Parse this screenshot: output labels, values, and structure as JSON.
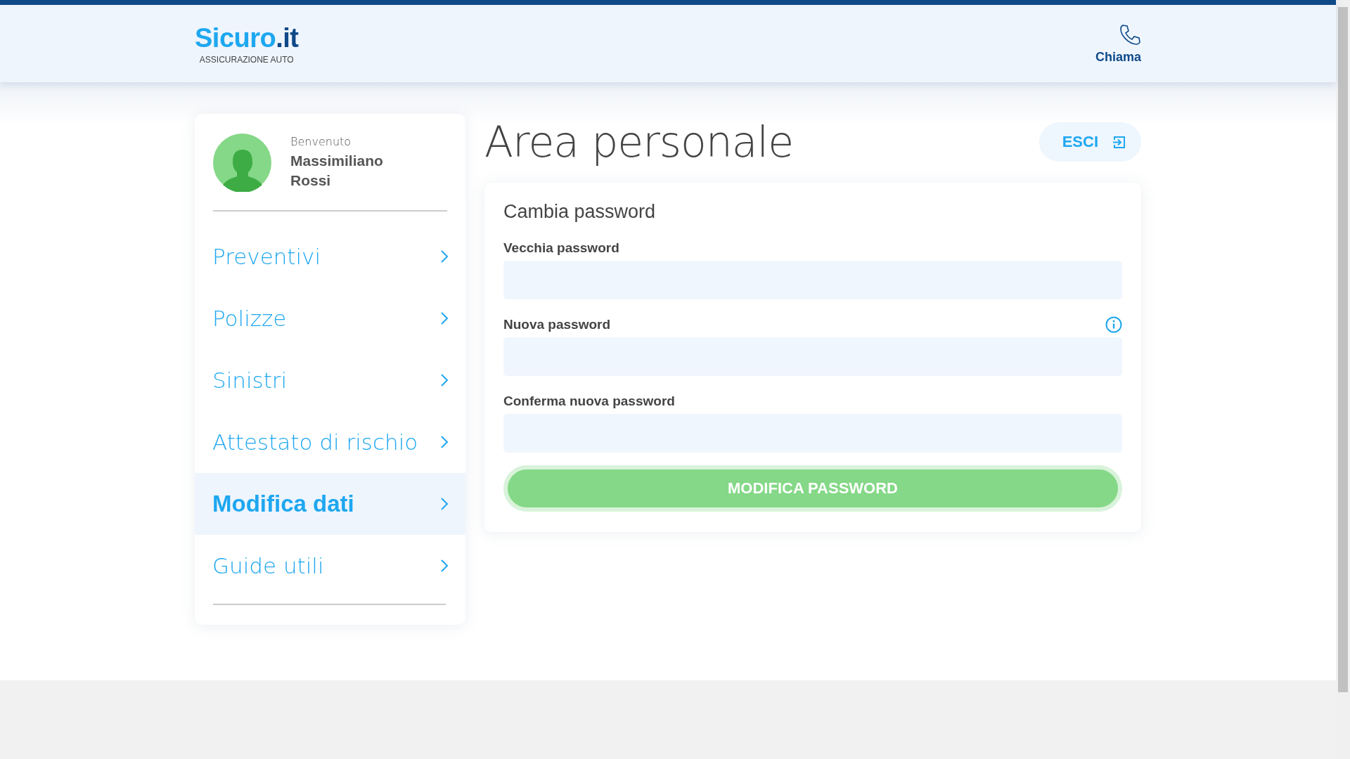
{
  "header": {
    "logo_name": "Sicuro",
    "logo_tld": ".it",
    "tagline": "ASSICURAZIONE AUTO",
    "call_label": "Chiama"
  },
  "user": {
    "greeting": "Benvenuto",
    "name": "Massimiliano Rossi"
  },
  "menu": [
    {
      "label": "Preventivi",
      "selected": false
    },
    {
      "label": "Polizze",
      "selected": false
    },
    {
      "label": "Sinistri",
      "selected": false
    },
    {
      "label": "Attestato di rischio",
      "selected": false
    },
    {
      "label": "Modifica dati",
      "selected": true
    },
    {
      "label": "Guide utili",
      "selected": false
    }
  ],
  "page_title": "Area personale",
  "logout_label": "ESCI",
  "form": {
    "title": "Cambia password",
    "fields": [
      {
        "label": "Vecchia password",
        "info": false
      },
      {
        "label": "Nuova password",
        "info": true
      },
      {
        "label": "Conferma nuova password",
        "info": false
      }
    ],
    "submit": "MODIFICA PASSWORD"
  }
}
